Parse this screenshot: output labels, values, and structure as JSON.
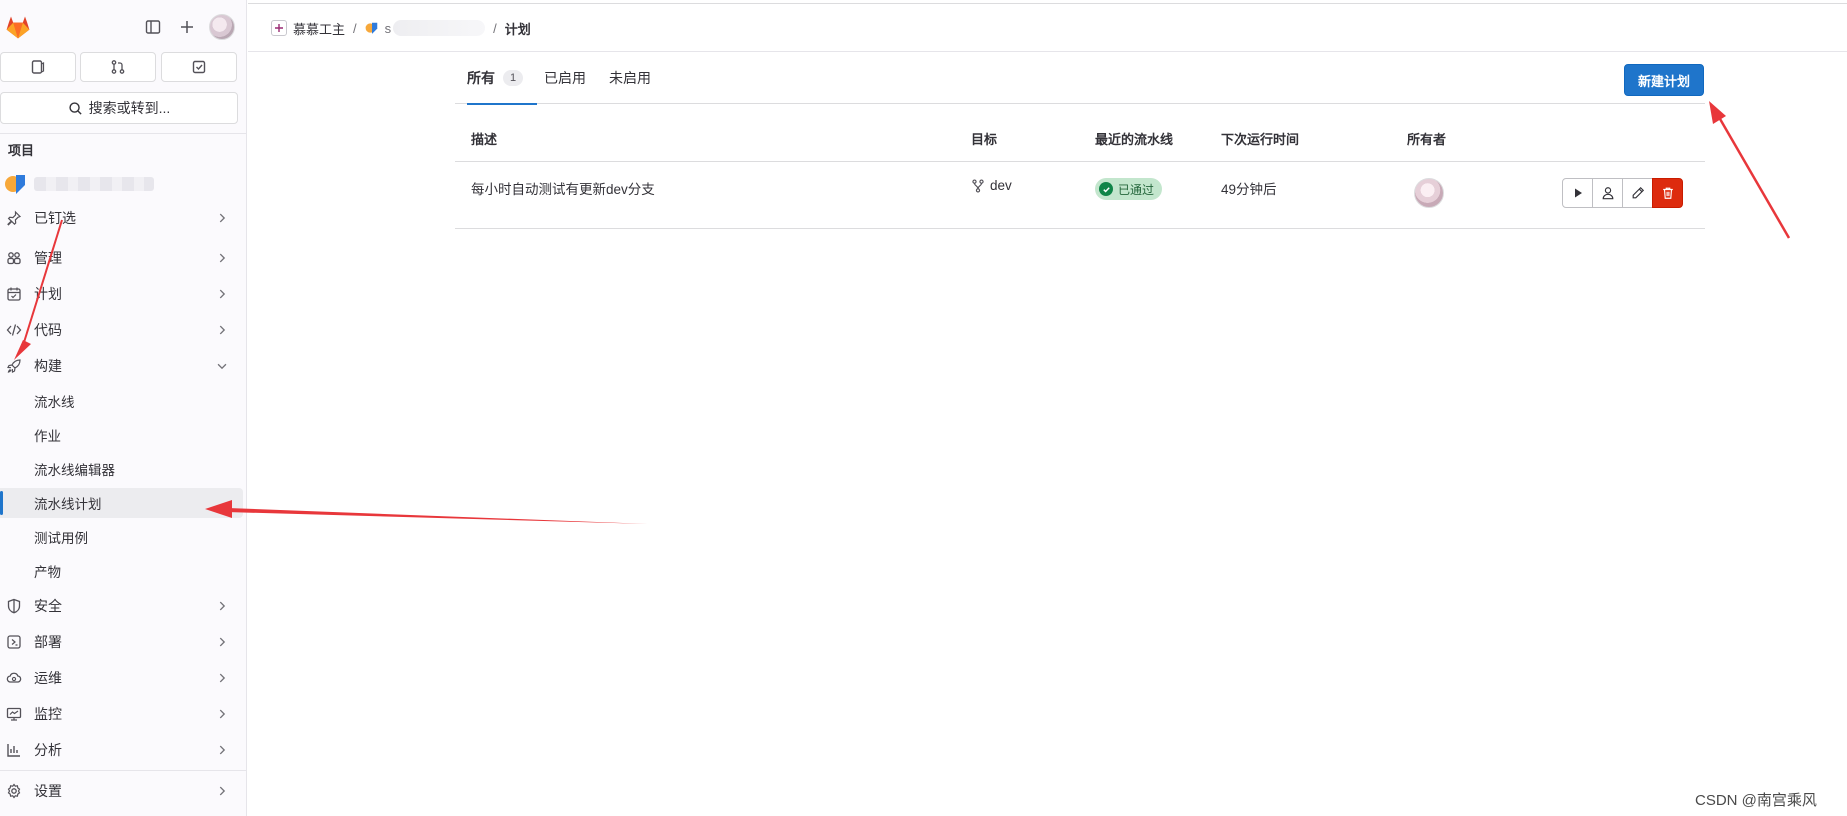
{
  "sidebar": {
    "search_label": "搜索或转到...",
    "section_heading": "项目",
    "project_name": "",
    "items": [
      {
        "label": "已钉选",
        "icon": "pin-icon"
      },
      {
        "label": "管理",
        "icon": "users-icon"
      },
      {
        "label": "计划",
        "icon": "calendar-icon"
      },
      {
        "label": "代码",
        "icon": "code-icon"
      },
      {
        "label": "构建",
        "icon": "rocket-icon"
      }
    ],
    "build_subitems": [
      {
        "label": "流水线"
      },
      {
        "label": "作业"
      },
      {
        "label": "流水线编辑器"
      },
      {
        "label": "流水线计划",
        "active": true
      },
      {
        "label": "测试用例"
      },
      {
        "label": "产物"
      }
    ],
    "items_after": [
      {
        "label": "安全",
        "icon": "shield-icon"
      },
      {
        "label": "部署",
        "icon": "deploy-icon"
      },
      {
        "label": "运维",
        "icon": "monitor-cloud-icon"
      },
      {
        "label": "监控",
        "icon": "screen-icon"
      },
      {
        "label": "分析",
        "icon": "chart-icon"
      },
      {
        "label": "设置",
        "icon": "gear-icon"
      }
    ]
  },
  "breadcrumb": {
    "group": "慕慕工主",
    "project_visible": "s",
    "current": "计划"
  },
  "tabs": [
    {
      "label": "所有",
      "count": "1",
      "active": true
    },
    {
      "label": "已启用"
    },
    {
      "label": "未启用"
    }
  ],
  "new_button_label": "新建计划",
  "table": {
    "headers": [
      "描述",
      "目标",
      "最近的流水线",
      "下次运行时间",
      "所有者"
    ],
    "rows": [
      {
        "description": "每小时自动测试有更新dev分支",
        "target": "dev",
        "last_pipeline_status": "已通过",
        "next_run": "49分钟后"
      }
    ]
  },
  "colors": {
    "accent": "#1f75cb",
    "danger": "#dd2b0e",
    "success": "#108548",
    "arrow": "#e8373b"
  },
  "watermark": "CSDN @南宫乘风"
}
